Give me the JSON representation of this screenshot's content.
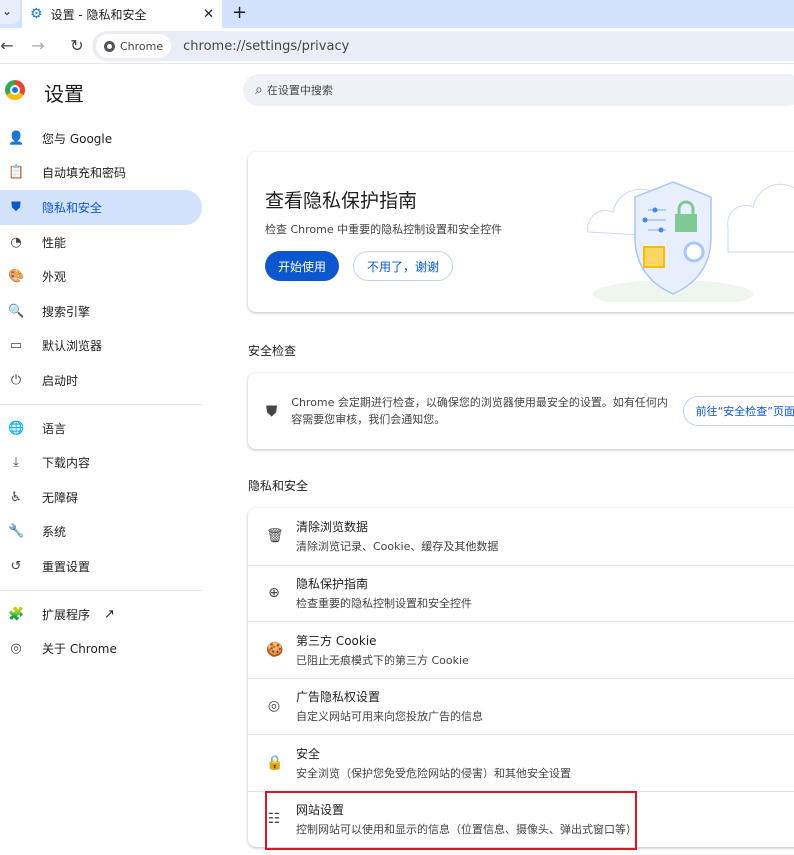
{
  "tab": {
    "title": "设置 - 隐私和安全",
    "close": "✕",
    "new_tab": "+",
    "prev": "⌄"
  },
  "toolbar": {
    "back": "←",
    "forward": "→",
    "reload": "↻",
    "chip": "Chrome",
    "url": "chrome://settings/privacy"
  },
  "header": {
    "title": "设置",
    "search_placeholder": "在设置中搜索"
  },
  "sidebar": {
    "items": [
      {
        "label": "您与 Google",
        "icon": "person-icon",
        "glyph": "👤"
      },
      {
        "label": "自动填充和密码",
        "icon": "clipboard-icon",
        "glyph": "📋"
      },
      {
        "label": "隐私和安全",
        "icon": "shield-icon",
        "glyph": "⛊",
        "selected": true
      },
      {
        "label": "性能",
        "icon": "speedometer-icon",
        "glyph": "◔"
      },
      {
        "label": "外观",
        "icon": "palette-icon",
        "glyph": "🎨"
      },
      {
        "label": "搜索引擎",
        "icon": "search-icon",
        "glyph": "🔍"
      },
      {
        "label": "默认浏览器",
        "icon": "browser-icon",
        "glyph": "▭"
      },
      {
        "label": "启动时",
        "icon": "power-icon",
        "glyph": "⏻"
      },
      {
        "label": "语言",
        "icon": "globe-icon",
        "glyph": "🌐"
      },
      {
        "label": "下载内容",
        "icon": "download-icon",
        "glyph": "⤓"
      },
      {
        "label": "无障碍",
        "icon": "accessibility-icon",
        "glyph": "♿"
      },
      {
        "label": "系统",
        "icon": "wrench-icon",
        "glyph": "🔧"
      },
      {
        "label": "重置设置",
        "icon": "history-icon",
        "glyph": "↺"
      },
      {
        "label": "扩展程序",
        "icon": "puzzle-icon",
        "glyph": "🧩",
        "external": "↗"
      },
      {
        "label": "关于 Chrome",
        "icon": "chrome-icon",
        "glyph": "◎"
      }
    ]
  },
  "promo": {
    "title": "查看隐私保护指南",
    "desc": "检查 Chrome 中重要的隐私控制设置和安全控件",
    "start": "开始使用",
    "dismiss": "不用了，谢谢"
  },
  "safety": {
    "heading": "安全检查",
    "text": "Chrome 会定期进行检查，以确保您的浏览器使用最安全的设置。如有任何内容需要您审核，我们会通知您。",
    "button": "前往“安全检查”页面"
  },
  "privacy": {
    "heading": "隐私和安全",
    "rows": [
      {
        "title": "清除浏览数据",
        "desc": "清除浏览记录、Cookie、缓存及其他数据",
        "icon": "trash-icon",
        "glyph": "🗑"
      },
      {
        "title": "隐私保护指南",
        "desc": "检查重要的隐私控制设置和安全控件",
        "icon": "compass-icon",
        "glyph": "⊕"
      },
      {
        "title": "第三方 Cookie",
        "desc": "已阻止无痕模式下的第三方 Cookie",
        "icon": "cookie-icon",
        "glyph": "🍪"
      },
      {
        "title": "广告隐私权设置",
        "desc": "自定义网站可用来向您投放广告的信息",
        "icon": "ad-privacy-icon",
        "glyph": "◎"
      },
      {
        "title": "安全",
        "desc": "安全浏览（保护您免受危险网站的侵害）和其他安全设置",
        "icon": "lock-icon",
        "glyph": "🔒"
      },
      {
        "title": "网站设置",
        "desc": "控制网站可以使用和显示的信息（位置信息、摄像头、弹出式窗口等）",
        "icon": "tune-icon",
        "glyph": "☷"
      }
    ]
  },
  "colors": {
    "accent": "#0b57d0",
    "selected_bg": "#d3e3fd",
    "highlight": "#e0141e"
  }
}
